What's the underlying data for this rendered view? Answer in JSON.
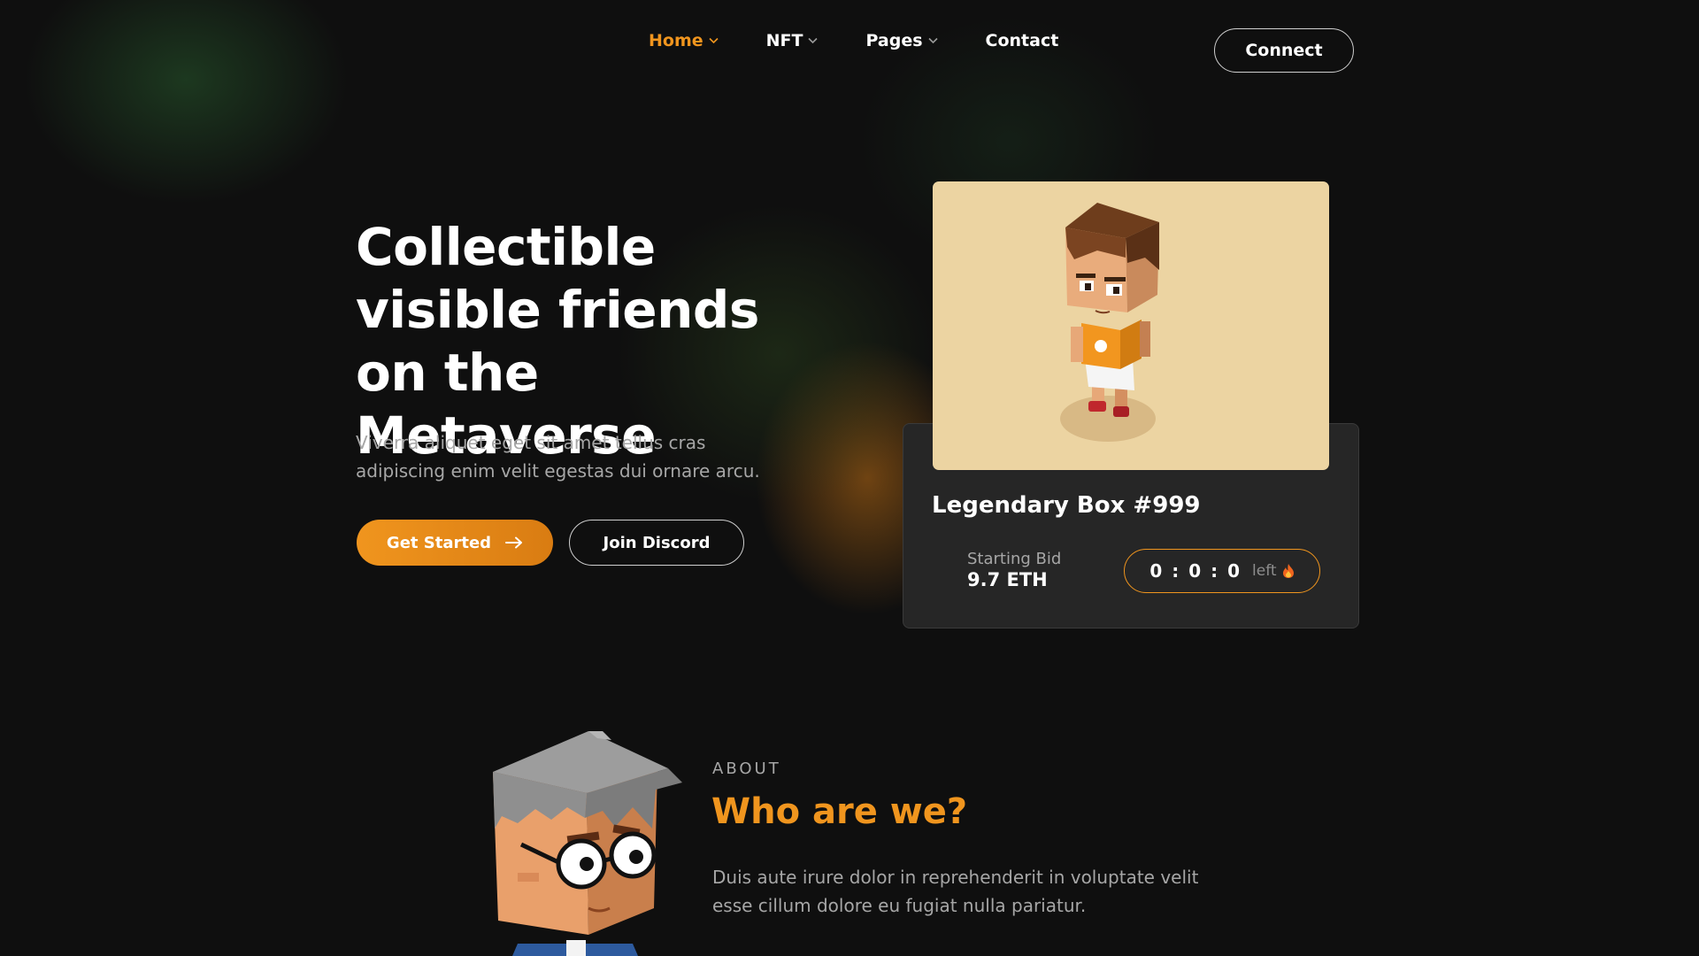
{
  "nav": {
    "items": [
      {
        "label": "Home",
        "has_dropdown": true,
        "active": true
      },
      {
        "label": "NFT",
        "has_dropdown": true,
        "active": false
      },
      {
        "label": "Pages",
        "has_dropdown": true,
        "active": false
      },
      {
        "label": "Contact",
        "has_dropdown": false,
        "active": false
      }
    ],
    "connect_label": "Connect"
  },
  "hero": {
    "title_lines": [
      "Collectible",
      "visible friends",
      "on the Metaverse"
    ],
    "description": "Viverra aliquet eget sit amet tellus cras adipiscing enim velit egestas dui ornare arcu.",
    "primary_button": {
      "label": "Get Started",
      "icon": "arrow-right-icon"
    },
    "secondary_button": {
      "label": "Join Discord"
    }
  },
  "card": {
    "title": "Legendary Box #999",
    "bid_label": "Starting Bid",
    "bid_value": "9.7 ETH",
    "timer": "0 : 0 : 0",
    "timer_suffix": "left",
    "timer_icon": "fire-icon",
    "image": "cube-character-basketball"
  },
  "about": {
    "eyebrow": "ABOUT",
    "title": "Who are we?",
    "description": "Duis aute irure dolor in reprehenderit in voluptate velit esse cillum dolore eu fugiat nulla pariatur.",
    "image": "cube-character-glasses"
  },
  "colors": {
    "accent": "#f0951e",
    "background": "#0f0f0f",
    "card_panel": "#262626",
    "card_image_bg": "#ecd4a2",
    "muted_text": "#a6a6a6"
  }
}
